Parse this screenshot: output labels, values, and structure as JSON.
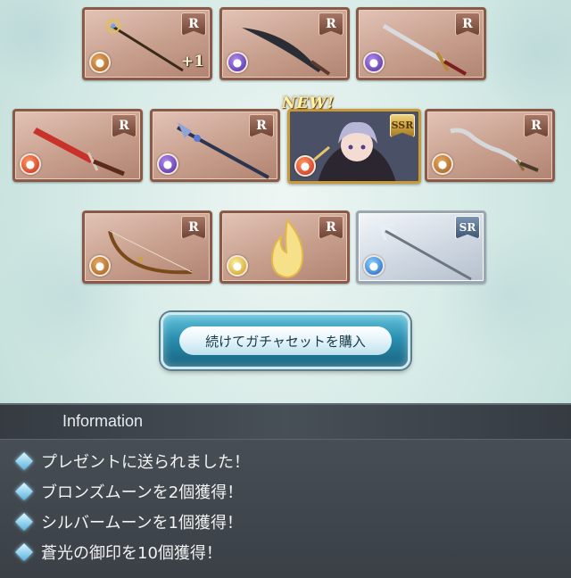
{
  "cards": [
    {
      "id": "card-1",
      "rarity": "R",
      "element": "earth",
      "plus": "+1",
      "new": ""
    },
    {
      "id": "card-2",
      "rarity": "R",
      "element": "dark",
      "plus": "",
      "new": ""
    },
    {
      "id": "card-3",
      "rarity": "R",
      "element": "dark",
      "plus": "",
      "new": ""
    },
    {
      "id": "card-4",
      "rarity": "R",
      "element": "fire",
      "plus": "",
      "new": ""
    },
    {
      "id": "card-5",
      "rarity": "R",
      "element": "dark",
      "plus": "",
      "new": ""
    },
    {
      "id": "card-6",
      "rarity": "SSR",
      "element": "fire",
      "plus": "",
      "new": "NEW!"
    },
    {
      "id": "card-7",
      "rarity": "R",
      "element": "earth",
      "plus": "",
      "new": ""
    },
    {
      "id": "card-8",
      "rarity": "R",
      "element": "earth",
      "plus": "",
      "new": ""
    },
    {
      "id": "card-9",
      "rarity": "R",
      "element": "light",
      "plus": "",
      "new": ""
    },
    {
      "id": "card-10",
      "rarity": "SR",
      "element": "water",
      "plus": "",
      "new": ""
    }
  ],
  "buy_button": {
    "label": "続けてガチャセットを購入"
  },
  "info": {
    "title": "Information",
    "lines": [
      "プレゼントに送られました！",
      "ブロンズムーンを2個獲得！",
      "シルバームーンを1個獲得！",
      "蒼光の御印を10個獲得！"
    ]
  },
  "colors": {
    "panel": "#3a4046",
    "button": "#2b8fb0",
    "card_frame": "#8a5a48"
  }
}
